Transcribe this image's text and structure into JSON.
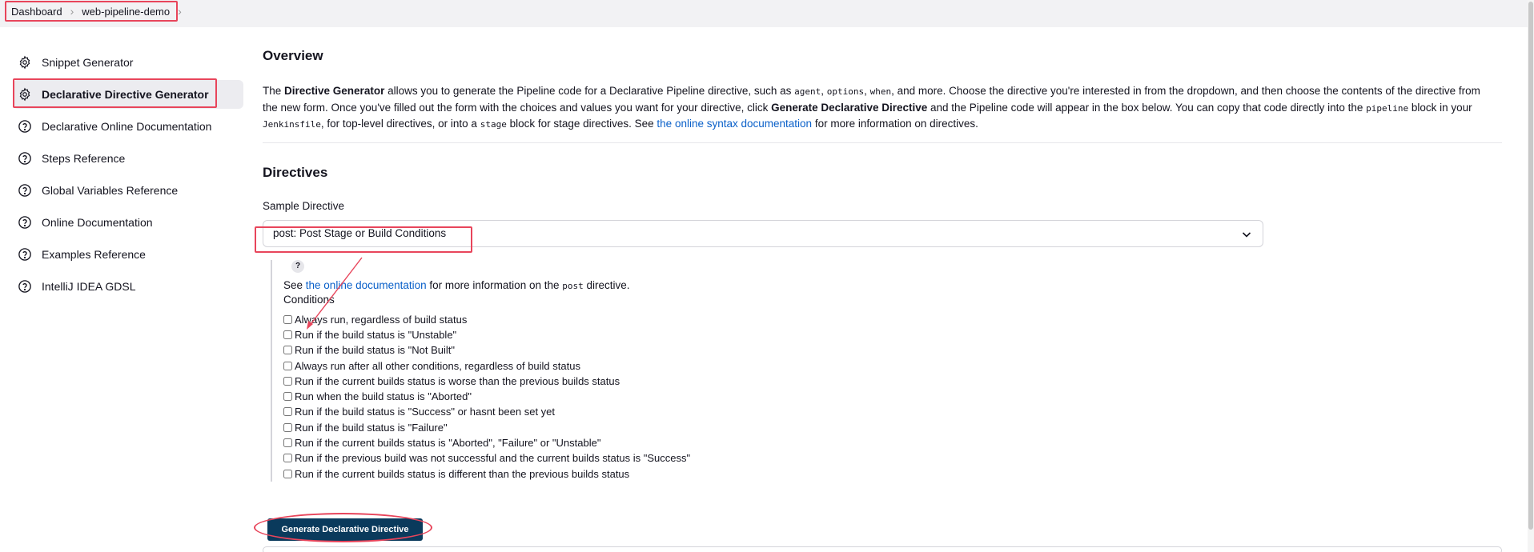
{
  "breadcrumb": {
    "items": [
      "Dashboard",
      "web-pipeline-demo"
    ]
  },
  "sidebar": {
    "items": [
      {
        "label": "Snippet Generator",
        "icon": "gear-icon"
      },
      {
        "label": "Declarative Directive Generator",
        "icon": "gear-icon",
        "active": true
      },
      {
        "label": "Declarative Online Documentation",
        "icon": "help-circle-icon"
      },
      {
        "label": "Steps Reference",
        "icon": "help-circle-icon"
      },
      {
        "label": "Global Variables Reference",
        "icon": "help-circle-icon"
      },
      {
        "label": "Online Documentation",
        "icon": "help-circle-icon"
      },
      {
        "label": "Examples Reference",
        "icon": "help-circle-icon"
      },
      {
        "label": "IntelliJ IDEA GDSL",
        "icon": "help-circle-icon"
      }
    ]
  },
  "overview": {
    "title": "Overview",
    "p1": "The ",
    "b1": "Directive Generator",
    "p2": " allows you to generate the Pipeline code for a Declarative Pipeline directive, such as ",
    "c1": "agent",
    "p3": ", ",
    "c2": "options",
    "p4": ", ",
    "c3": "when",
    "p5": ", and more. Choose the directive you're interested in from the dropdown, and then choose the contents of the directive from the new form. Once you've filled out the form with the choices and values you want for your directive, click ",
    "b2": "Generate Declarative Directive",
    "p6": " and the Pipeline code will appear in the box below. You can copy that code directly into the ",
    "c4": "pipeline",
    "p7": " block in your ",
    "c5": "Jenkinsfile",
    "p8": ", for top-level directives, or into a ",
    "c6": "stage",
    "p9": " block for stage directives. See ",
    "link": "the online syntax documentation",
    "p10": " for more information on directives."
  },
  "directives": {
    "title": "Directives",
    "sample_label": "Sample Directive",
    "selected": "post: Post Stage or Build Conditions",
    "help_glyph": "?",
    "see_prefix": "See ",
    "see_link": "the online documentation",
    "see_mid": " for more information on the ",
    "see_code": "post",
    "see_suffix": " directive.",
    "conditions_label": "Conditions",
    "conditions": [
      "Always run, regardless of build status",
      "Run if the build status is \"Unstable\"",
      "Run if the build status is \"Not Built\"",
      "Always run after all other conditions, regardless of build status",
      "Run if the current builds status is worse than the previous builds status",
      "Run when the build status is \"Aborted\"",
      "Run if the build status is \"Success\" or hasnt been set yet",
      "Run if the build status is \"Failure\"",
      "Run if the current builds status is \"Aborted\", \"Failure\" or \"Unstable\"",
      "Run if the previous build was not successful and the current builds status is \"Success\"",
      "Run if the current builds status is different than the previous builds status"
    ],
    "generate_label": "Generate Declarative Directive"
  },
  "colors": {
    "highlight": "#e8455b",
    "link": "#0a60c9",
    "button": "#0a3a5c"
  }
}
